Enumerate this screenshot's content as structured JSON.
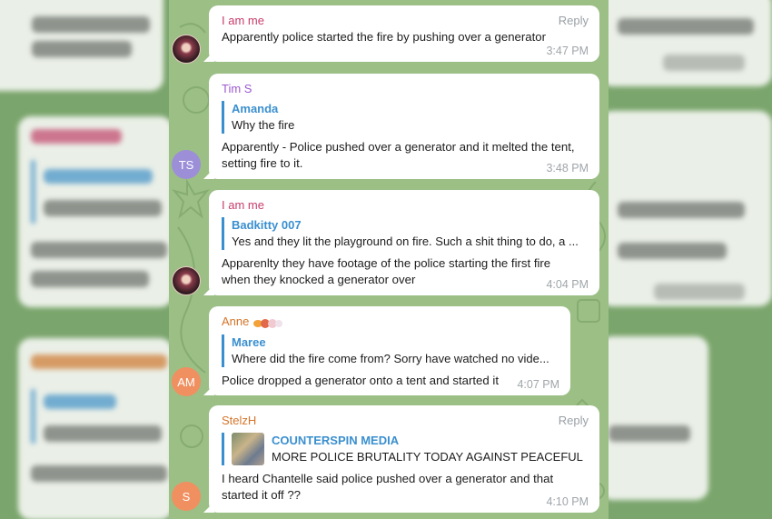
{
  "messages": [
    {
      "sender": "I am me",
      "sender_color": "#c83c6a",
      "reply_label": "Reply",
      "text": "Apparently police started the fire by pushing over a generator",
      "time": "3:47 PM"
    },
    {
      "sender": "Tim S",
      "sender_color": "#9b59d0",
      "avatar_initials": "TS",
      "avatar_color": "#9c8fd8",
      "quote": {
        "name": "Amanda",
        "text": "Why the fire"
      },
      "text_line1": "Apparently - Police pushed over a generator and it melted the tent,",
      "text_line2": "setting fire to it.",
      "time": "3:48 PM"
    },
    {
      "sender": "I am me",
      "sender_color": "#c83c6a",
      "quote": {
        "name": "Badkitty 007",
        "text": "Yes and they lit the playground on fire. Such a shit thing to do, a ..."
      },
      "text_line1": "Apparenlty they have footage of the police starting the first fire",
      "text_line2": "when they knocked a generator over",
      "time": "4:04 PM"
    },
    {
      "sender": "Anne",
      "sender_color": "#d4752a",
      "avatar_initials": "AM",
      "avatar_color": "#f09060",
      "quote": {
        "name": "Maree",
        "text": "Where did the fire come from? Sorry have watched no vide..."
      },
      "text": "Police dropped a generator onto a tent and started it",
      "time": "4:07 PM"
    },
    {
      "sender": "StelzH",
      "sender_color": "#d4752a",
      "reply_label": "Reply",
      "avatar_initials": "S",
      "avatar_color": "#f09060",
      "quote": {
        "name": "COUNTERSPIN MEDIA",
        "text": "MORE POLICE BRUTALITY TODAY AGAINST PEACEFUL PR..."
      },
      "text_line1": "I heard Chantelle said police pushed over a generator and that",
      "text_line2": "started it off ??",
      "time": "4:10 PM"
    }
  ]
}
